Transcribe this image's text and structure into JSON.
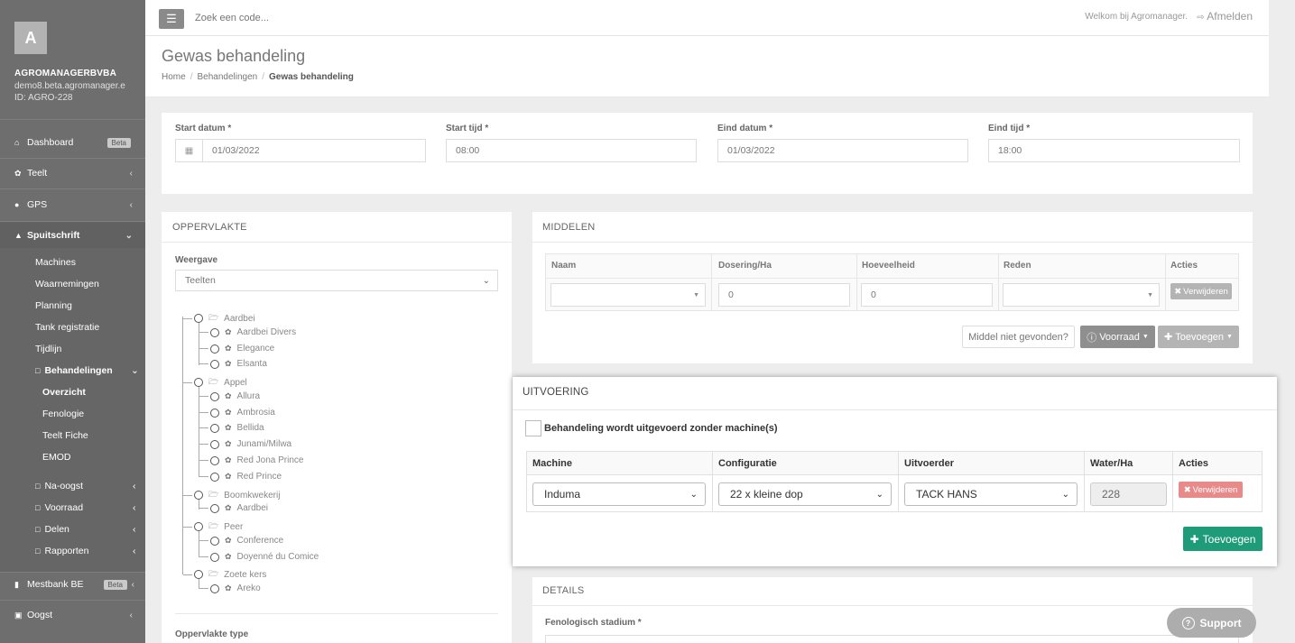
{
  "sidebar": {
    "avatar_letter": "A",
    "company": "AGROMANAGERBVBA",
    "domain": "demo8.beta.agromanager.e",
    "client_id": "ID: AGRO-228",
    "items": [
      {
        "label": "Dashboard",
        "icon": "home-icon",
        "badge": "Beta"
      },
      {
        "label": "Teelt",
        "icon": "leaf-icon"
      },
      {
        "label": "GPS",
        "icon": "map-marker-icon"
      },
      {
        "label": "Spuitschrift",
        "icon": "drop-icon"
      },
      {
        "label": "Mestbank BE",
        "icon": "book-icon",
        "badge": "Beta"
      },
      {
        "label": "Oogst",
        "icon": "basket-icon"
      }
    ],
    "spuitschrift_sub": [
      "Machines",
      "Waarnemingen",
      "Planning",
      "Tank registratie",
      "Tijdlijn",
      "Behandelingen"
    ],
    "behandelingen_sub": [
      "Overzicht",
      "Fenologie",
      "Teelt Fiche",
      "EMOD"
    ],
    "folder_items": [
      "Na-oogst",
      "Voorraad",
      "Delen",
      "Rapporten"
    ]
  },
  "topbar": {
    "search_placeholder": "Zoek een code...",
    "welcome": "Welkom bij Agromanager.",
    "logout": "Afmelden"
  },
  "header": {
    "title": "Gewas behandeling",
    "breadcrumb": [
      "Home",
      "Behandelingen",
      "Gewas behandeling"
    ]
  },
  "dates": {
    "start_date_label": "Start datum *",
    "start_date": "01/03/2022",
    "start_time_label": "Start tijd *",
    "start_time": "08:00",
    "end_date_label": "Eind datum *",
    "end_date": "01/03/2022",
    "end_time_label": "Eind tijd *",
    "end_time": "18:00"
  },
  "oppervlakte": {
    "title": "OPPERVLAKTE",
    "weergave_label": "Weergave",
    "weergave_value": "Teelten",
    "type_label": "Oppervlakte type",
    "tree": [
      {
        "name": "Aardbei",
        "children": [
          "Aardbei Divers",
          "Elegance",
          "Elsanta"
        ]
      },
      {
        "name": "Appel",
        "children": [
          "Allura",
          "Ambrosia",
          "Bellida",
          "Junami/Milwa",
          "Red Jona Prince",
          "Red Prince"
        ]
      },
      {
        "name": "Boomkwekerij",
        "children": [
          "Aardbei"
        ]
      },
      {
        "name": "Peer",
        "children": [
          "Conference",
          "Doyenné du Comice"
        ]
      },
      {
        "name": "Zoete kers",
        "children": [
          "Areko"
        ]
      }
    ]
  },
  "middelen": {
    "title": "MIDDELEN",
    "columns": [
      "Naam",
      "Dosering/Ha",
      "Hoeveelheid",
      "Reden",
      "Acties"
    ],
    "row": {
      "dosering": "0",
      "hoeveelheid": "0",
      "delete": "Verwijderen"
    },
    "not_found": "Middel niet gevonden?",
    "voorraad": "Voorraad",
    "toevoegen": "Toevoegen"
  },
  "uitvoering": {
    "title": "UITVOERING",
    "no_machine_label": "Behandeling wordt uitgevoerd zonder machine(s)",
    "columns": [
      "Machine",
      "Configuratie",
      "Uitvoerder",
      "Water/Ha",
      "Acties"
    ],
    "row": {
      "machine": "Induma",
      "configuratie": "22 x kleine dop",
      "uitvoerder": "TACK HANS",
      "water": "228",
      "delete": "Verwijderen"
    },
    "add": "Toevoegen"
  },
  "details": {
    "title": "DETAILS",
    "stadium_label": "Fenologisch stadium *"
  },
  "support": "Support",
  "colors": {
    "sidebar": "#6e6e6e",
    "accent_green": "#1e9c7a",
    "danger": "#e88a8a"
  }
}
